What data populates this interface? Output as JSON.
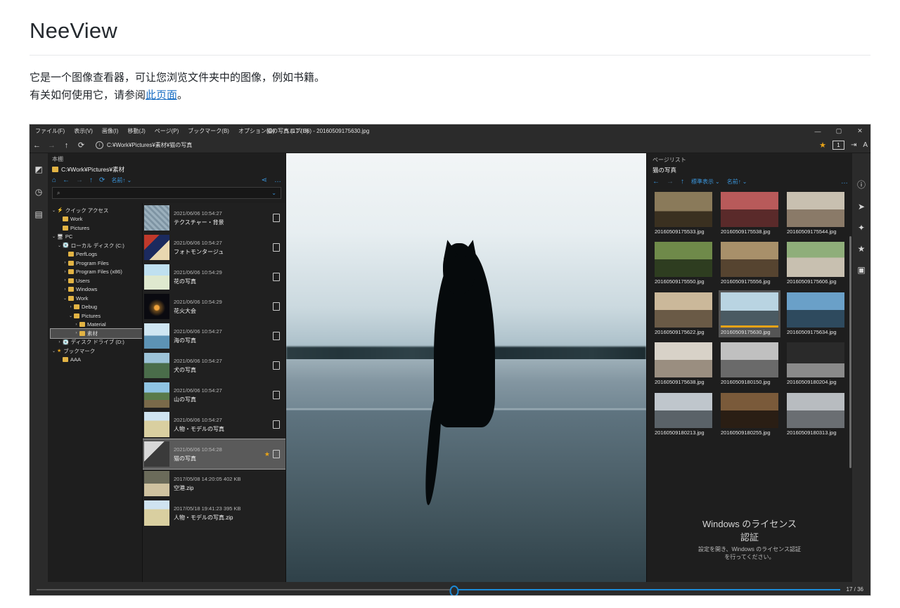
{
  "document": {
    "title": "NeeView",
    "paragraph_line1": "它是一个图像查看器，可让您浏览文件夹中的图像，例如书籍。",
    "paragraph_line2_prefix": "有关如何使用它，请参阅",
    "paragraph_link": "此页面",
    "paragraph_line2_suffix": "。"
  },
  "app": {
    "menu": [
      {
        "label": "ファイル(F)"
      },
      {
        "label": "表示(V)"
      },
      {
        "label": "画像(I)"
      },
      {
        "label": "移動(J)"
      },
      {
        "label": "ページ(P)"
      },
      {
        "label": "ブックマーク(B)"
      },
      {
        "label": "オプション(O)"
      },
      {
        "label": "ヘルプ(H)"
      }
    ],
    "window_title": "猫の写真 (17 / 36) - 20160509175630.jpg",
    "window_controls": {
      "minimize": "—",
      "maximize": "▢",
      "close": "✕"
    },
    "address": {
      "back": "←",
      "forward": "→",
      "up": "↑",
      "reload": "⟳",
      "path": "C:¥Work¥Pictures¥素材¥猫の写真"
    },
    "toolbar_right": {
      "star": "★",
      "badge": "1",
      "arrow": "⇥",
      "font": "A"
    },
    "left_rail": [
      {
        "name": "bookshelf-icon",
        "glyph": "◩"
      },
      {
        "name": "history-icon",
        "glyph": "◷"
      },
      {
        "name": "filelist-icon",
        "glyph": "▤"
      }
    ],
    "right_rail": [
      {
        "name": "information-icon",
        "glyph": "ⓘ"
      },
      {
        "name": "navigate-icon",
        "glyph": "➤"
      },
      {
        "name": "effect-icon",
        "glyph": "✦"
      },
      {
        "name": "bookmark-icon",
        "glyph": "★"
      },
      {
        "name": "save-icon",
        "glyph": "▣"
      }
    ]
  },
  "left_panel": {
    "caption": "本棚",
    "path": "C:¥Work¥Pictures¥素材",
    "tools": {
      "home": "⌂",
      "back": "←",
      "forward": "→",
      "up": "↑",
      "reload": "⟳",
      "sort": "名前↑",
      "sort_chevron": "⌄",
      "share": "⋖",
      "more": "…"
    },
    "search": {
      "value": "",
      "placeholder": "",
      "icon": "🔍",
      "chevron": "⌄"
    },
    "tree": [
      {
        "indent": 0,
        "chevron": "⌄",
        "icon": "⚡",
        "label": "クイック アクセス",
        "type": "quick",
        "selected": false
      },
      {
        "indent": 1,
        "chevron": "",
        "icon": "folder",
        "label": "Work",
        "type": "folder",
        "selected": false
      },
      {
        "indent": 1,
        "chevron": "",
        "icon": "folder",
        "label": "Pictures",
        "type": "folder",
        "selected": false
      },
      {
        "indent": 0,
        "chevron": "⌄",
        "icon": "🖥",
        "label": "PC",
        "type": "pc",
        "selected": false
      },
      {
        "indent": 1,
        "chevron": "⌄",
        "icon": "💽",
        "label": "ローカル ディスク (C:)",
        "type": "drive",
        "selected": false
      },
      {
        "indent": 2,
        "chevron": "",
        "icon": "folder",
        "label": "PerfLogs",
        "type": "folder",
        "selected": false
      },
      {
        "indent": 2,
        "chevron": "›",
        "icon": "folder",
        "label": "Program Files",
        "type": "folder",
        "selected": false
      },
      {
        "indent": 2,
        "chevron": "›",
        "icon": "folder",
        "label": "Program Files (x86)",
        "type": "folder",
        "selected": false
      },
      {
        "indent": 2,
        "chevron": "›",
        "icon": "folder",
        "label": "Users",
        "type": "folder",
        "selected": false
      },
      {
        "indent": 2,
        "chevron": "›",
        "icon": "folder",
        "label": "Windows",
        "type": "folder",
        "selected": false
      },
      {
        "indent": 2,
        "chevron": "⌄",
        "icon": "folder",
        "label": "Work",
        "type": "folder",
        "selected": false
      },
      {
        "indent": 3,
        "chevron": "›",
        "icon": "folder",
        "label": "Debug",
        "type": "folder",
        "selected": false
      },
      {
        "indent": 3,
        "chevron": "⌄",
        "icon": "folder",
        "label": "Pictures",
        "type": "folder",
        "selected": false
      },
      {
        "indent": 4,
        "chevron": "›",
        "icon": "folder",
        "label": "Material",
        "type": "folder",
        "selected": false
      },
      {
        "indent": 4,
        "chevron": "›",
        "icon": "folder",
        "label": "素材",
        "type": "folder",
        "selected": true
      },
      {
        "indent": 1,
        "chevron": "›",
        "icon": "💽",
        "label": "ディスク ドライブ (D:)",
        "type": "drive",
        "selected": false
      },
      {
        "indent": 0,
        "chevron": "⌄",
        "icon": "★",
        "label": "ブックマーク",
        "type": "bookmark",
        "selected": false
      },
      {
        "indent": 1,
        "chevron": "",
        "icon": "folder",
        "label": "AAA",
        "type": "folder",
        "selected": false
      }
    ],
    "files": [
      {
        "date": "2021/06/06 10:54:27",
        "size": "",
        "name": "テクスチャー・背景",
        "selected": false,
        "starred": false,
        "thumb": "texture"
      },
      {
        "date": "2021/06/06 10:54:27",
        "size": "",
        "name": "フォトモンタージュ",
        "selected": false,
        "starred": false,
        "thumb": "montage"
      },
      {
        "date": "2021/06/06 10:54:29",
        "size": "",
        "name": "花の写真",
        "selected": false,
        "starred": false,
        "thumb": "flower"
      },
      {
        "date": "2021/06/06 10:54:29",
        "size": "",
        "name": "花火大会",
        "selected": false,
        "starred": false,
        "thumb": "fireworks"
      },
      {
        "date": "2021/06/06 10:54:27",
        "size": "",
        "name": "海の写真",
        "selected": false,
        "starred": false,
        "thumb": "sea"
      },
      {
        "date": "2021/06/06 10:54:27",
        "size": "",
        "name": "犬の写真",
        "selected": false,
        "starred": false,
        "thumb": "dog"
      },
      {
        "date": "2021/06/06 10:54:27",
        "size": "",
        "name": "山の写真",
        "selected": false,
        "starred": false,
        "thumb": "mountain"
      },
      {
        "date": "2021/06/06 10:54:27",
        "size": "",
        "name": "人物・モデルの写真",
        "selected": false,
        "starred": false,
        "thumb": "person"
      },
      {
        "date": "2021/06/06 10:54:28",
        "size": "",
        "name": "猫の写真",
        "selected": true,
        "starred": true,
        "thumb": "cat"
      },
      {
        "date": "2017/05/08 14:20:05",
        "size": "402 KB",
        "name": "空港.zip",
        "selected": false,
        "starred": false,
        "thumb": "airport"
      },
      {
        "date": "2017/05/18 19:41:23",
        "size": "395 KB",
        "name": "人物・モデルの写真.zip",
        "selected": false,
        "starred": false,
        "thumb": "person2"
      }
    ]
  },
  "page_list": {
    "caption": "ページリスト",
    "title": "猫の写真",
    "tools": {
      "back": "←",
      "forward": "→",
      "up": "↑",
      "view_mode": "標準表示",
      "view_chevron": "⌄",
      "sort": "名前↑",
      "sort_chevron": "⌄",
      "more": "…"
    },
    "thumbnails": [
      {
        "name": "20160509175533.jpg",
        "selected": false,
        "thumb": "c1"
      },
      {
        "name": "20160509175538.jpg",
        "selected": false,
        "thumb": "c2"
      },
      {
        "name": "20160509175544.jpg",
        "selected": false,
        "thumb": "c3"
      },
      {
        "name": "20160509175550.jpg",
        "selected": false,
        "thumb": "c4"
      },
      {
        "name": "20160509175556.jpg",
        "selected": false,
        "thumb": "c5"
      },
      {
        "name": "20160509175606.jpg",
        "selected": false,
        "thumb": "c6"
      },
      {
        "name": "20160509175622.jpg",
        "selected": false,
        "thumb": "c7"
      },
      {
        "name": "20160509175630.jpg",
        "selected": true,
        "thumb": "c8"
      },
      {
        "name": "20160509175634.jpg",
        "selected": false,
        "thumb": "c9"
      },
      {
        "name": "20160509175638.jpg",
        "selected": false,
        "thumb": "c10"
      },
      {
        "name": "20160509180150.jpg",
        "selected": false,
        "thumb": "c11"
      },
      {
        "name": "20160509180204.jpg",
        "selected": false,
        "thumb": "c12"
      },
      {
        "name": "20160509180213.jpg",
        "selected": false,
        "thumb": "c13"
      },
      {
        "name": "20160509180255.jpg",
        "selected": false,
        "thumb": "c14"
      },
      {
        "name": "20160509180313.jpg",
        "selected": false,
        "thumb": "c15"
      }
    ]
  },
  "watermark": {
    "title": "Windows のライセンス認証",
    "subtitle": "設定を開き、Windows のライセンス認証を行ってください。"
  },
  "status": {
    "page_indicator": "17 / 36",
    "slider_position_percent": 52
  },
  "colors": {
    "accent_blue": "#1c8ad6",
    "star_gold": "#e8a317",
    "link_blue": "#1a6fc4",
    "panel_bg": "#1e1e1e",
    "chrome_bg": "#2b2b2b"
  }
}
